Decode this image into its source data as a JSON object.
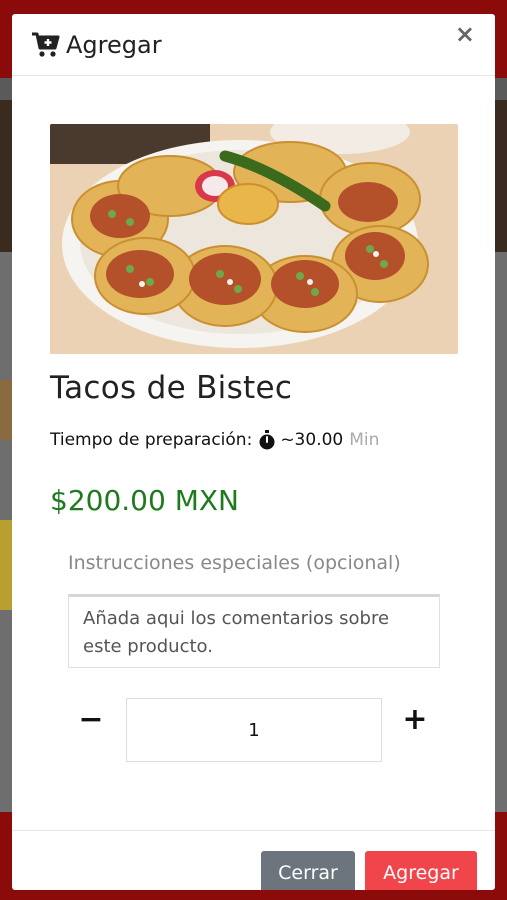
{
  "modal": {
    "title": "Agregar",
    "close_glyph": "×",
    "icons": {
      "cart": "cart-plus-icon",
      "close": "close-icon",
      "timer": "stopwatch-icon"
    }
  },
  "product": {
    "image_alt": "tacos-image",
    "name": "Tacos de Bistec",
    "prep_label": "Tiempo de preparación:",
    "prep_time": "~30.00",
    "prep_unit": "Min",
    "price": "$200.00 MXN"
  },
  "notes": {
    "label": "Instrucciones especiales (opcional)",
    "placeholder": "Añada aqui los comentarios sobre este producto."
  },
  "quantity": {
    "minus": "−",
    "plus": "+",
    "value": "1"
  },
  "footer": {
    "close_label": "Cerrar",
    "add_label": "Agregar"
  },
  "colors": {
    "price": "#1f7a1f",
    "close_button": "#6c757d",
    "add_button": "#f0454b",
    "backdrop_red": "#8b0b0b"
  }
}
